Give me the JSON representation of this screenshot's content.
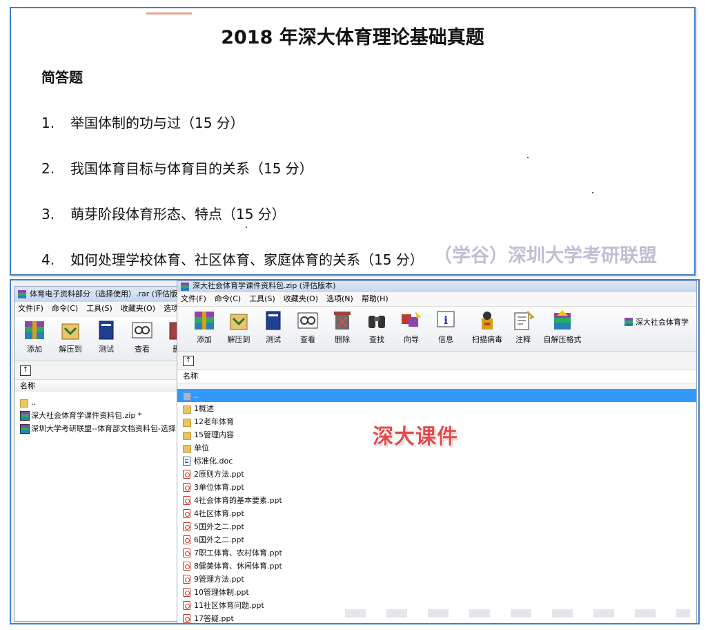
{
  "document": {
    "title": "2018 年深大体育理论基础真题",
    "section": "简答题",
    "questions": [
      {
        "num": "1.",
        "text": "举国体制的功与过（15 分）"
      },
      {
        "num": "2.",
        "text": "我国体育目标与体育目的关系（15 分）"
      },
      {
        "num": "3.",
        "text": "萌芽阶段体育形态、特点（15 分）"
      },
      {
        "num": "4.",
        "text": "如何处理学校体育、社区体育、家庭体育的关系（15 分）"
      }
    ],
    "watermark": "（学谷）深圳大学考研联盟"
  },
  "left_window": {
    "title": "体育电子资料部分（选择使用）.rar (评估版本",
    "menu": [
      "文件(F)",
      "命令(C)",
      "工具(S)",
      "收藏夹(O)",
      "选项"
    ],
    "tools": [
      "添加",
      "解压到",
      "测试",
      "查看",
      "删"
    ],
    "up_icon": "up-arrow-icon",
    "column": "名称",
    "files": [
      {
        "name": "..",
        "icon": "folder-icon"
      },
      {
        "name": "深大社会体育学课件资料包.zip *",
        "icon": "archive-icon"
      },
      {
        "name": "深圳大学考研联盟--体育部文档资料包-选择",
        "icon": "archive-icon"
      }
    ]
  },
  "right_window": {
    "title": "深大社会体育学课件资料包.zip (评估版本)",
    "menu": [
      "文件(F)",
      "命令(C)",
      "工具(S)",
      "收藏夹(O)",
      "选项(N)",
      "帮助(H)"
    ],
    "tools": [
      "添加",
      "解压到",
      "测试",
      "查看",
      "删除",
      "查找",
      "向导",
      "信息",
      "扫描病毒",
      "注释",
      "自解压格式"
    ],
    "path_label": "深大社会体育学",
    "column": "名称",
    "files": [
      {
        "name": "..",
        "icon": "folder-up-icon",
        "selected": true
      },
      {
        "name": "1概述",
        "icon": "folder-icon"
      },
      {
        "name": "12老年体育",
        "icon": "folder-icon"
      },
      {
        "name": "15管理内容",
        "icon": "folder-icon"
      },
      {
        "name": "单位",
        "icon": "folder-icon"
      },
      {
        "name": "标准化.doc",
        "icon": "doc-icon"
      },
      {
        "name": "2原则方法.ppt",
        "icon": "ppt-icon"
      },
      {
        "name": "3单位体育.ppt",
        "icon": "ppt-icon"
      },
      {
        "name": "4社会体育的基本要素.ppt",
        "icon": "ppt-icon"
      },
      {
        "name": "4社区体育.ppt",
        "icon": "ppt-icon"
      },
      {
        "name": "5国外之二.ppt",
        "icon": "ppt-icon"
      },
      {
        "name": "6国外之二.ppt",
        "icon": "ppt-icon"
      },
      {
        "name": "7职工体育、农村体育.ppt",
        "icon": "ppt-icon"
      },
      {
        "name": "8健美体育、休闲体育.ppt",
        "icon": "ppt-icon"
      },
      {
        "name": "9管理方法.ppt",
        "icon": "ppt-icon"
      },
      {
        "name": "10管理体制.ppt",
        "icon": "ppt-icon"
      },
      {
        "name": "11社区体育问题.ppt",
        "icon": "ppt-icon"
      },
      {
        "name": "17答疑.ppt",
        "icon": "ppt-icon"
      }
    ]
  },
  "overlay_label": "深大课件",
  "colors": {
    "frame": "#3d80c9",
    "selection": "#3399ff",
    "overlay": "#e14b4b",
    "watermark": "#a9aac6"
  }
}
